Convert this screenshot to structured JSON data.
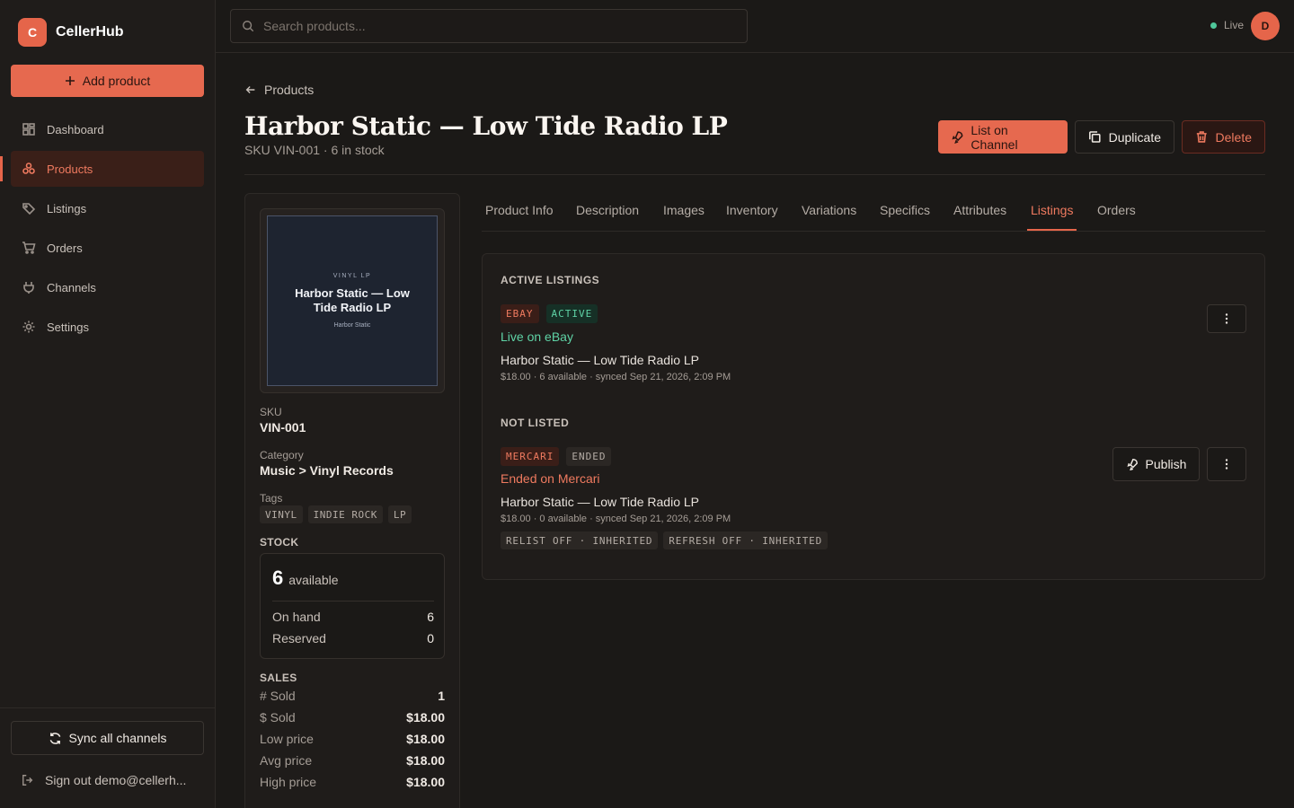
{
  "brand": {
    "logo_letter": "C",
    "name": "CellerHub"
  },
  "sidebar": {
    "add_label": "Add product",
    "items": [
      {
        "label": "Dashboard",
        "icon": "grid-icon"
      },
      {
        "label": "Products",
        "icon": "boxes-icon",
        "active": true
      },
      {
        "label": "Listings",
        "icon": "tag-icon"
      },
      {
        "label": "Orders",
        "icon": "cart-icon"
      },
      {
        "label": "Channels",
        "icon": "plug-icon"
      },
      {
        "label": "Settings",
        "icon": "gear-icon"
      }
    ],
    "sync_label": "Sync all channels",
    "signout_label": "Sign out demo@cellerh..."
  },
  "topbar": {
    "search_placeholder": "Search products...",
    "live_label": "Live",
    "avatar_letter": "D"
  },
  "header": {
    "back_label": "Products",
    "title": "Harbor Static — Low Tide Radio LP",
    "subtitle": "SKU VIN-001 · 6 in stock",
    "actions": {
      "list_label": "List on Channel",
      "duplicate_label": "Duplicate",
      "delete_label": "Delete"
    }
  },
  "product": {
    "cover": {
      "kicker": "VINYL LP",
      "title": "Harbor Static — Low Tide Radio LP",
      "artist": "Harbor Static"
    },
    "sku_label": "SKU",
    "sku": "VIN-001",
    "category_label": "Category",
    "category": "Music > Vinyl Records",
    "tags_label": "Tags",
    "tags": [
      "VINYL",
      "INDIE ROCK",
      "LP"
    ],
    "stock": {
      "label": "STOCK",
      "available": "6",
      "available_label": "available",
      "on_hand_label": "On hand",
      "on_hand": "6",
      "reserved_label": "Reserved",
      "reserved": "0"
    },
    "sales": {
      "label": "SALES",
      "rows": [
        {
          "label": "# Sold",
          "value": "1"
        },
        {
          "label": "$ Sold",
          "value": "$18.00"
        },
        {
          "label": "Low price",
          "value": "$18.00"
        },
        {
          "label": "Avg price",
          "value": "$18.00"
        },
        {
          "label": "High price",
          "value": "$18.00"
        }
      ]
    }
  },
  "tabs": [
    "Product Info",
    "Description",
    "Images",
    "Inventory",
    "Variations",
    "Specifics",
    "Attributes",
    "Listings",
    "Orders"
  ],
  "active_tab": "Listings",
  "listings": {
    "active_section": "ACTIVE LISTINGS",
    "active": {
      "channel": "EBAY",
      "state": "ACTIVE",
      "status": "Live on eBay",
      "title": "Harbor Static — Low Tide Radio LP",
      "meta": "$18.00 · 6 available · synced Sep 21, 2026, 2:09 PM"
    },
    "not_listed_section": "NOT LISTED",
    "not_listed": {
      "channel": "MERCARI",
      "state": "ENDED",
      "status": "Ended on Mercari",
      "title": "Harbor Static — Low Tide Radio LP",
      "meta": "$18.00 · 0 available · synced Sep 21, 2026, 2:09 PM",
      "chips": [
        "RELIST OFF · INHERITED",
        "REFRESH OFF · INHERITED"
      ],
      "publish_label": "Publish"
    }
  },
  "colors": {
    "accent": "#e5654a",
    "success": "#5fd3a6",
    "background": "#1b1917"
  }
}
